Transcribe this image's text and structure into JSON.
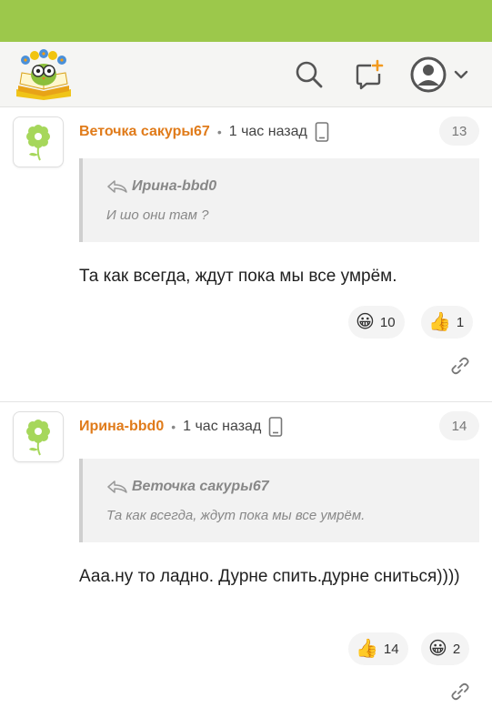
{
  "header": {
    "logo_icon": "book-owl-logo-icon",
    "search_icon": "search-icon",
    "add_icon": "add-post-icon",
    "user_icon": "user-avatar-icon",
    "chevron_icon": "chevron-down-icon"
  },
  "colors": {
    "topbar": "#9cc84b",
    "author": "#e07b1a"
  },
  "comments": [
    {
      "author": "Веточка сакуры67",
      "separator": "•",
      "time": "1 час назад",
      "number": "13",
      "quote_author": "Ирина-bbd0",
      "quote_text": "И шо они там ?",
      "text": "Та как всегда, ждут пока мы все умрём.",
      "reactions": [
        {
          "icon": "😀",
          "name": "smile-emoji-icon",
          "count": "10"
        },
        {
          "icon": "👍",
          "name": "thumbs-up-icon",
          "count": "1"
        }
      ]
    },
    {
      "author": "Ирина-bbd0",
      "separator": "•",
      "time": "1 час назад",
      "number": "14",
      "quote_author": "Веточка сакуры67",
      "quote_text": "Та как всегда, ждут пока мы все умрём.",
      "text": "Ааа.ну то ладно. Дурне спить.дурне сниться))))",
      "reactions": [
        {
          "icon": "👍",
          "name": "thumbs-up-icon",
          "count": "14"
        },
        {
          "icon": "😀",
          "name": "smile-emoji-icon",
          "count": "2"
        }
      ]
    }
  ]
}
